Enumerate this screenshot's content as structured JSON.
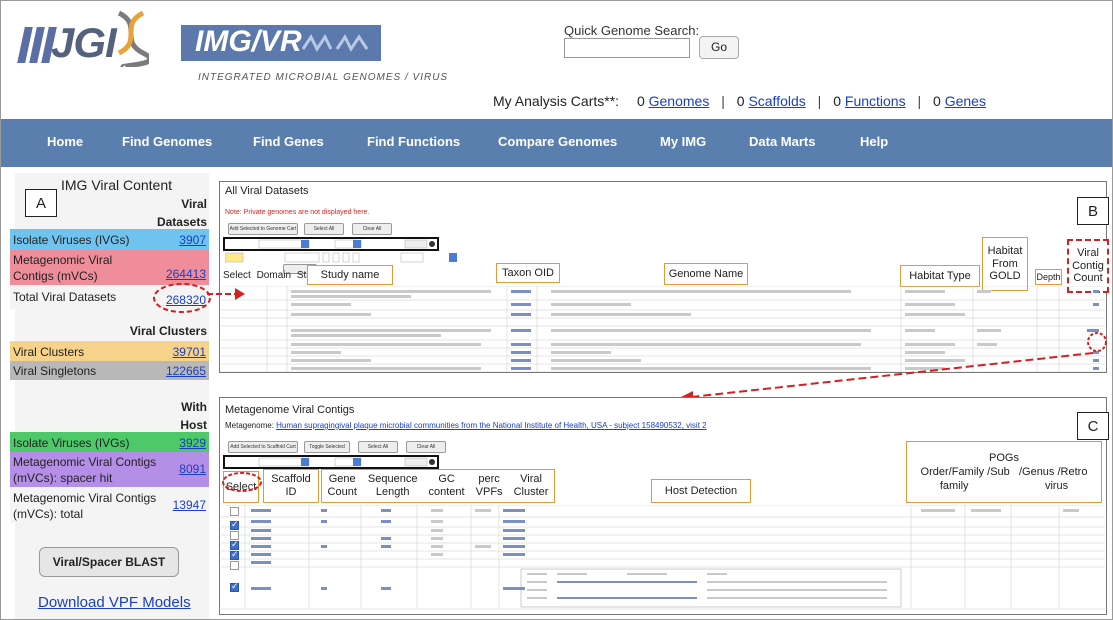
{
  "header": {
    "logo_jgi": "JGI",
    "logo_imgvr": "IMG/VR",
    "logo_subtitle": "INTEGRATED MICROBIAL GENOMES / VIRUS",
    "quick_search_label": "Quick Genome Search:",
    "go_button": "Go",
    "carts_label": "My Analysis Carts**:",
    "carts": [
      {
        "count": "0",
        "label": "Genomes"
      },
      {
        "count": "0",
        "label": "Scaffolds"
      },
      {
        "count": "0",
        "label": "Functions"
      },
      {
        "count": "0",
        "label": "Genes"
      }
    ]
  },
  "nav": [
    "Home",
    "Find Genomes",
    "Find Genes",
    "Find Functions",
    "Compare Genomes",
    "My IMG",
    "Data Marts",
    "Help"
  ],
  "sidebar": {
    "box_label": "A",
    "title": "IMG Viral Content",
    "viral_datasets_header": "Viral\nDatasets",
    "viral_clusters_header": "Viral Clusters",
    "with_host_header": "With\nHost",
    "datasets": [
      {
        "label": "Isolate Viruses (IVGs)",
        "value": "3907",
        "color": "#6fc3ef"
      },
      {
        "label": "Metagenomic Viral\nContigs (mVCs)",
        "value": "264413",
        "color": "#ef8e9a"
      },
      {
        "label": "Total Viral Datasets",
        "value": "268320",
        "color": "#f4f4f4"
      }
    ],
    "clusters": [
      {
        "label": "Viral Clusters",
        "value": "39701",
        "color": "#f7d28a"
      },
      {
        "label": "Viral Singletons",
        "value": "122665",
        "color": "#b8b8b8"
      }
    ],
    "host": [
      {
        "label": "Isolate Viruses (IVGs)",
        "value": "3929",
        "color": "#4ec96a"
      },
      {
        "label": "Metagenomic Viral Contigs\n(mVCs): spacer hit",
        "value": "8091",
        "color": "#b58ee8"
      },
      {
        "label": "Metagenomic Viral Contigs\n(mVCs): total",
        "value": "13947",
        "color": "#f4f4f4"
      }
    ],
    "blast_button": "Viral/Spacer BLAST",
    "download_link": "Download VPF Models"
  },
  "panel_b": {
    "box_label": "B",
    "title": "All Viral Datasets",
    "note": "Note: Private genomes are not displayed here.",
    "buttons": [
      "Add Selected to Genome Cart",
      "Select All",
      "Clear All"
    ],
    "columns_small": [
      "Select",
      "Domain",
      "Status"
    ],
    "callouts": [
      "Study name",
      "Taxon OID",
      "Genome Name",
      "Habitat Type",
      "Habitat\nFrom\nGOLD",
      "Depth",
      "Viral\nContig\nCount"
    ]
  },
  "panel_c": {
    "box_label": "C",
    "title": "Metagenome Viral Contigs",
    "metagenome_prefix": "Metagenome:",
    "metagenome_link": "Human supragingival plaque microbial communities from the National Institute of Health, USA - subject 158490532, visit 2",
    "buttons": [
      "Add Selected to Scaffold Cart",
      "Toggle Selected",
      "Select All",
      "Clear All"
    ],
    "callouts": [
      "Select",
      "Scaffold\nID",
      "Gene\nCount",
      "Sequence\nLength",
      "GC\ncontent",
      "perc\nVPFs",
      "Viral\nCluster",
      "Host Detection",
      "POGs\nOrder/Family /Sub   /Genus /Retro\nfamily                         virus"
    ]
  }
}
